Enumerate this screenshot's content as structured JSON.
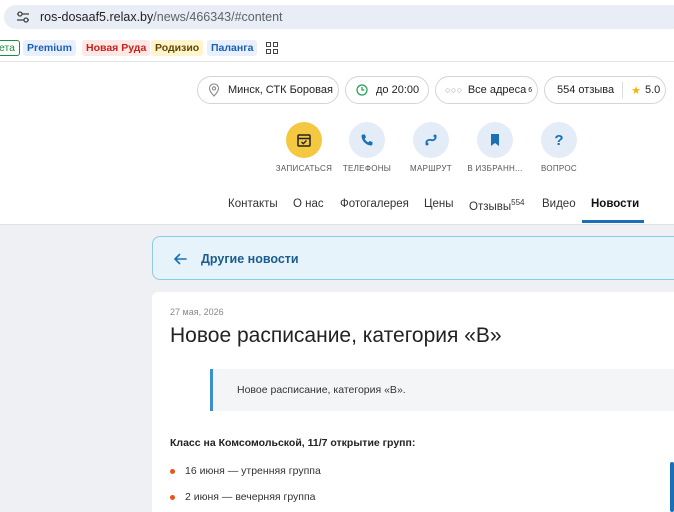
{
  "browser": {
    "url_host": "ros-dosaaf5.relax.by",
    "url_path": "/news/466343/#content"
  },
  "bookmarks": [
    {
      "label": "ета",
      "color": "#1e8e3e",
      "bg": "#ffffff",
      "border": "#1e8e3e"
    },
    {
      "label": "Premium",
      "color": "#1a5fb4",
      "bg": "#e8f0fe"
    },
    {
      "label": "Новая Руда",
      "color": "#c5221f",
      "bg": "#fde8e6"
    },
    {
      "label": "Родизио",
      "color": "#5f4b00",
      "bg": "#fff4cc"
    },
    {
      "label": "Паланга",
      "color": "#1a5fb4",
      "bg": "#e8f0fe"
    }
  ],
  "header": {
    "location": "Минск, СТК Боровая",
    "hours": "до 20:00",
    "addresses": "Все адреса",
    "addresses_count": "6",
    "reviews": "554 отзыва",
    "rating": "5.0"
  },
  "actions": [
    {
      "label": "ЗАПИСАТЬСЯ",
      "icon": "calendar-icon"
    },
    {
      "label": "ТЕЛЕФОНЫ",
      "icon": "phone-icon"
    },
    {
      "label": "МАРШРУТ",
      "icon": "route-icon"
    },
    {
      "label": "В ИЗБРАНН...",
      "icon": "bookmark-icon"
    },
    {
      "label": "ВОПРОС",
      "icon": "question-icon"
    }
  ],
  "nav": {
    "contacts": "Контакты",
    "about": "О нас",
    "gallery": "Фотогалерея",
    "prices": "Цены",
    "reviews": "Отзывы",
    "reviews_count": "554",
    "video": "Видео",
    "news": "Новости"
  },
  "back_link": "Другие новости",
  "article": {
    "date": "27 мая, 2026",
    "title": "Новое расписание, категория «В»",
    "quote": "Новое расписание, категория «В».",
    "subheading": "Класс на Комсомольской, 11/7 открытие групп:",
    "items": [
      "16 июня — утренняя группа",
      "2 июня — вечерняя группа"
    ]
  },
  "colors": {
    "accent": "#1a6fb5",
    "primary_action": "#f5c842",
    "bullet": "#e8541e"
  }
}
